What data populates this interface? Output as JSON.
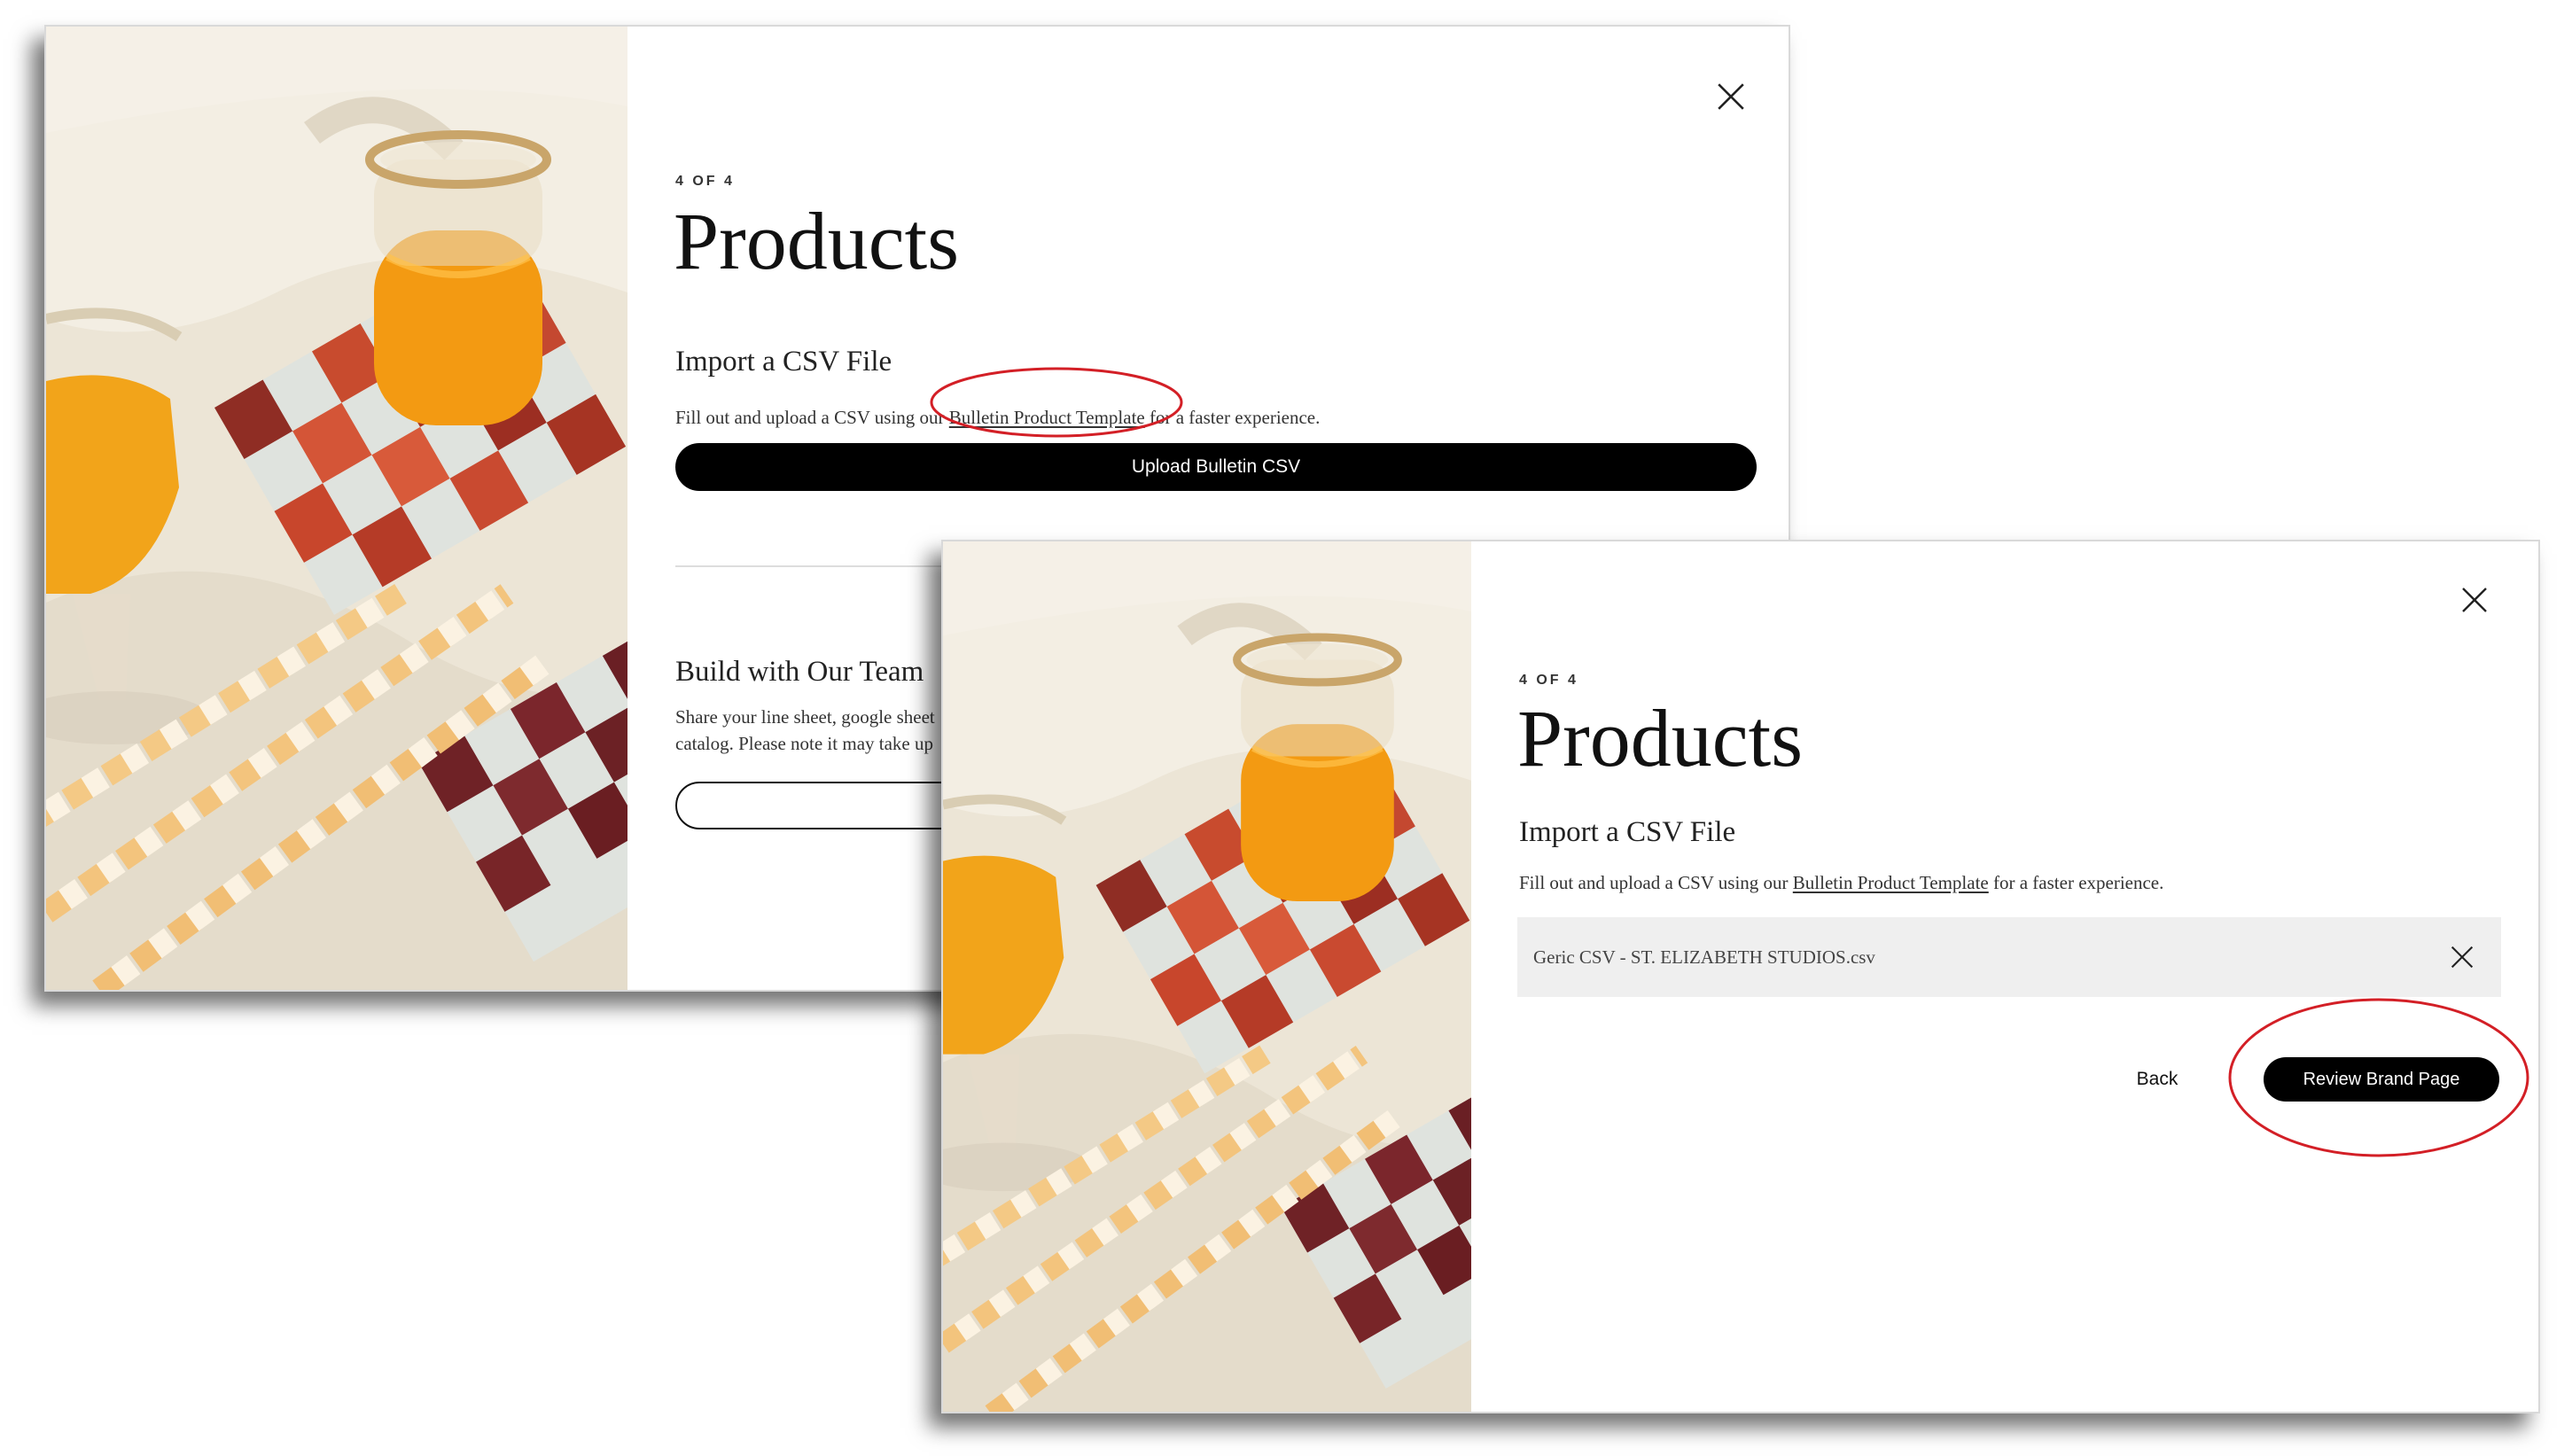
{
  "colors": {
    "accent": "#000000",
    "annotation": "#d31f26",
    "file_row_bg": "#efefef"
  },
  "icons": {
    "close": "close-icon",
    "remove_file": "close-icon"
  },
  "modal_before": {
    "step": "4 OF 4",
    "title": "Products",
    "import_heading": "Import a CSV File",
    "import_desc_prefix": "Fill out and upload a CSV using our ",
    "template_link": "Bulletin Product Template",
    "import_desc_suffix": " for a faster experience.",
    "upload_button": "Upload Bulletin CSV",
    "team_heading": "Build with Our Team",
    "team_desc_line1": "Share your line sheet, google sheet",
    "team_desc_line2": "catalog. Please note it may take up"
  },
  "modal_after": {
    "step": "4 OF 4",
    "title": "Products",
    "import_heading": "Import a CSV File",
    "import_desc_prefix": "Fill out and upload a CSV using our ",
    "template_link": "Bulletin Product Template",
    "import_desc_suffix": " for a faster experience.",
    "file_name": "Geric CSV - ST. ELIZABETH STUDIOS.csv",
    "back_button": "Back",
    "review_button": "Review Brand Page"
  }
}
